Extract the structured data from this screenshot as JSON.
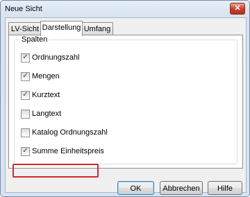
{
  "window": {
    "title": "Neue Sicht",
    "close_icon": "close-icon"
  },
  "tabs": [
    {
      "label": "LV-Sicht",
      "active": false
    },
    {
      "label": "Darstellung",
      "active": true
    },
    {
      "label": "Umfang",
      "active": false
    }
  ],
  "group": {
    "legend": "Spalten",
    "items": [
      {
        "label": "Ordnungszahl",
        "checked": true
      },
      {
        "label": "Mengen",
        "checked": true
      },
      {
        "label": "Kurztext",
        "checked": true
      },
      {
        "label": "Langtext",
        "checked": false
      },
      {
        "label": "Katalog Ordnungszahl",
        "checked": false
      },
      {
        "label": "Summe Einheitspreis",
        "checked": true,
        "highlighted": true
      }
    ]
  },
  "buttons": {
    "ok": "OK",
    "cancel": "Abbrechen",
    "help": "Hilfe"
  },
  "colors": {
    "highlight": "#d9252a",
    "check": "#1e395b"
  }
}
